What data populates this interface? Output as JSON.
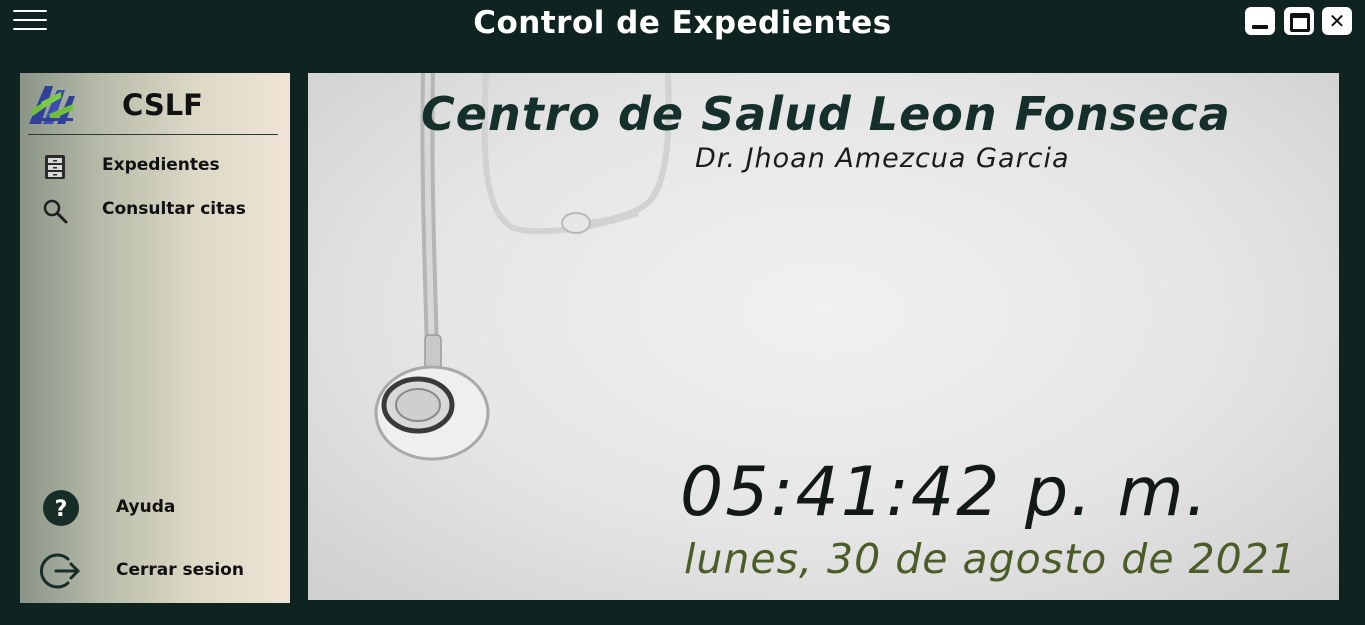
{
  "window": {
    "title": "Control de Expedientes",
    "menu_icon": "hamburger-menu-icon",
    "controls": [
      "minimize-icon",
      "maximize-icon",
      "close-icon"
    ],
    "close_glyph": "✕"
  },
  "sidebar": {
    "brand": "CSLF",
    "logo_icon": "clinic-logo-icon",
    "items": [
      {
        "label": "Expedientes",
        "icon": "file-cabinet-icon"
      },
      {
        "label": "Consultar citas",
        "icon": "search-icon"
      }
    ],
    "footer_items": [
      {
        "label": "Ayuda",
        "icon": "help-icon",
        "glyph": "?"
      },
      {
        "label": "Cerrar sesion",
        "icon": "logout-icon"
      }
    ]
  },
  "main": {
    "center_name": "Centro de Salud Leon Fonseca",
    "doctor_name": "Dr. Jhoan Amezcua Garcia",
    "time": "05:41:42 p. m.",
    "date": "lunes, 30 de agosto de 2021",
    "background_image": "stethoscope-photo"
  },
  "colors": {
    "window_bg": "#0f2421",
    "title_text": "#ffffff",
    "date_text": "#4a5c27",
    "heading_text": "#15302a"
  }
}
